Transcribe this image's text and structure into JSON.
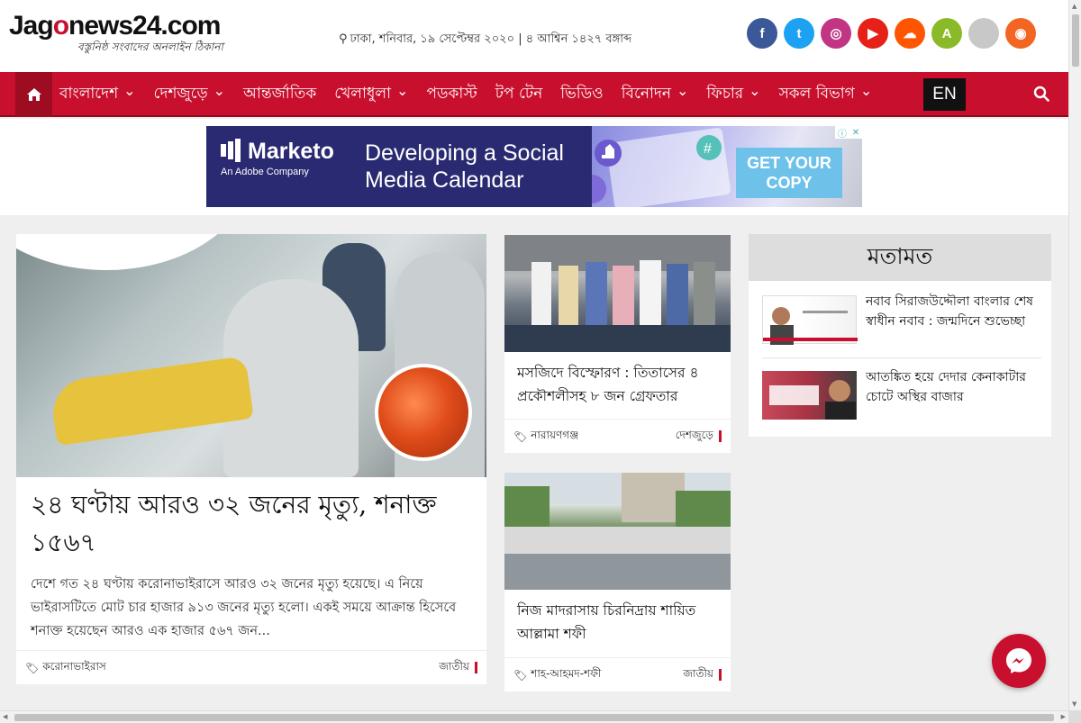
{
  "header": {
    "logo_text_prefix": "Jag",
    "logo_text_mark": "o",
    "logo_text_suffix": "news24.com",
    "logo_tagline": "বস্তুনিষ্ঠ সংবাদের অনলাইন ঠিকানা",
    "dateline": "ঢাকা, শনিবার, ১৯ সেপ্টেম্বর ২০২০ | ৪ আশ্বিন ১৪২৭ বঙ্গাব্দ",
    "socials": [
      {
        "icon": "facebook-icon",
        "glyph": "f",
        "color": "#3b5998"
      },
      {
        "icon": "twitter-icon",
        "glyph": "t",
        "color": "#1da1f2"
      },
      {
        "icon": "instagram-icon",
        "glyph": "◎",
        "color": "#c13584"
      },
      {
        "icon": "youtube-icon",
        "glyph": "▶",
        "color": "#e62117"
      },
      {
        "icon": "soundcloud-icon",
        "glyph": "☁",
        "color": "#ff5500"
      },
      {
        "icon": "android-icon",
        "glyph": "A",
        "color": "#8bba29"
      },
      {
        "icon": "apple-icon",
        "glyph": "",
        "color": "#c8c8c8"
      },
      {
        "icon": "rss-icon",
        "glyph": "◉",
        "color": "#f26522"
      }
    ]
  },
  "nav": {
    "items": [
      {
        "label": "বাংলাদেশ",
        "dropdown": true
      },
      {
        "label": "দেশজুড়ে",
        "dropdown": true
      },
      {
        "label": "আন্তর্জাতিক",
        "dropdown": false
      },
      {
        "label": "খেলাধুলা",
        "dropdown": true
      },
      {
        "label": "পডকাস্ট",
        "dropdown": false
      },
      {
        "label": "টপ টেন",
        "dropdown": false
      },
      {
        "label": "ভিডিও",
        "dropdown": false
      },
      {
        "label": "বিনোদন",
        "dropdown": true
      },
      {
        "label": "ফিচার",
        "dropdown": true
      },
      {
        "label": "সকল বিভাগ",
        "dropdown": true
      }
    ],
    "en_label": "EN",
    "accent": "#c8102e"
  },
  "ad": {
    "brand": "Marketo",
    "brand_sub": "An Adobe Company",
    "headline_line1": "Developing a Social",
    "headline_line2": "Media Calendar",
    "cta_line1": "GET YOUR",
    "cta_line2": "COPY"
  },
  "lead": {
    "title": "২৪ ঘণ্টায় আরও ৩২ জনের মৃত্যু, শনাক্ত ১৫৬৭",
    "summary": "দেশে গত ২৪ ঘণ্টায় করোনাভাইরাসে আরও ৩২ জনের মৃত্যু হয়েছে। এ নিয়ে ভাইরাসটিতে মোট চার হাজার ৯১৩ জনের মৃত্যু হলো। একই সময়ে আক্রান্ত হিসেবে শনাক্ত হয়েছেন আরও এক হাজার ৫৬৭ জন...",
    "tag": "করোনাভাইরাস",
    "category": "জাতীয়"
  },
  "cards": [
    {
      "title": "মসজিদে বিস্ফোরণ : তিতাসের ৪ প্রকৌশলীসহ ৮ জন গ্রেফতার",
      "tag": "নারায়ণগঞ্জ",
      "category": "দেশজুড়ে"
    },
    {
      "title": "নিজ মাদরাসায় চিরনিদ্রায় শায়িত আল্লামা শফী",
      "tag": "শাহ-আহমদ-শফী",
      "category": "জাতীয়"
    }
  ],
  "opinion": {
    "heading": "মতামত",
    "items": [
      {
        "title": "নবাব সিরাজউদ্দৌলা বাংলার শেষ স্বাধীন নবাব : জন্মদিনে শুভেচ্ছা"
      },
      {
        "title": "আতঙ্কিত হয়ে দেদার কেনাকাটার চোটে অস্থির বাজার"
      }
    ]
  }
}
